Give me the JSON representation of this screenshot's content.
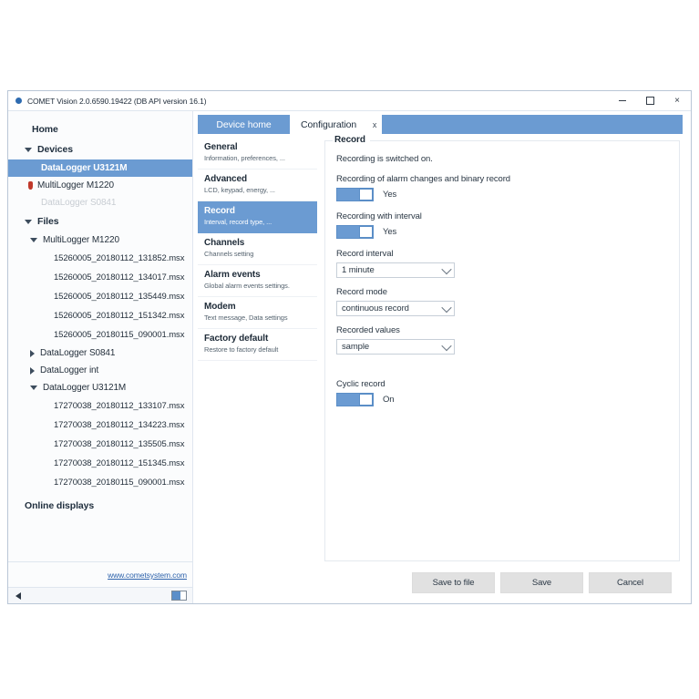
{
  "window": {
    "title": "COMET Vision 2.0.6590.19422 (DB API version 16.1)",
    "minimize_label": "",
    "maximize_label": "",
    "close_label": "×"
  },
  "sidebar": {
    "home_label": "Home",
    "devices_label": "Devices",
    "devices": [
      {
        "label": "DataLogger U3121M",
        "state": "selected"
      },
      {
        "label": "MultiLogger M1220",
        "state": "alarm"
      },
      {
        "label": "DataLogger S0841",
        "state": "disabled"
      }
    ],
    "files_label": "Files",
    "file_groups": [
      {
        "label": "MultiLogger M1220",
        "expanded": true,
        "files": [
          "15260005_20180112_131852.msx",
          "15260005_20180112_134017.msx",
          "15260005_20180112_135449.msx",
          "15260005_20180112_151342.msx",
          "15260005_20180115_090001.msx"
        ]
      },
      {
        "label": "DataLogger S0841",
        "expanded": false,
        "files": []
      },
      {
        "label": "DataLogger int",
        "expanded": false,
        "files": []
      },
      {
        "label": "DataLogger U3121M",
        "expanded": true,
        "files": [
          "17270038_20180112_133107.msx",
          "17270038_20180112_134223.msx",
          "17270038_20180112_135505.msx",
          "17270038_20180112_151345.msx",
          "17270038_20180115_090001.msx"
        ]
      }
    ],
    "online_displays_label": "Online displays",
    "web_link": "www.cometsystem.com"
  },
  "tabs": [
    {
      "label": "Device home",
      "active": true
    },
    {
      "label": "Configuration",
      "active": false
    }
  ],
  "tab_close_label": "x",
  "config_nav": [
    {
      "title": "General",
      "subtitle": "Information, preferences, ...",
      "active": false
    },
    {
      "title": "Advanced",
      "subtitle": "LCD, keypad, energy, ...",
      "active": false
    },
    {
      "title": "Record",
      "subtitle": "Interval, record type, ...",
      "active": true
    },
    {
      "title": "Channels",
      "subtitle": "Channels setting",
      "active": false
    },
    {
      "title": "Alarm events",
      "subtitle": "Global alarm events settings.",
      "active": false
    },
    {
      "title": "Modem",
      "subtitle": "Text message, Data settings",
      "active": false
    },
    {
      "title": "Factory default",
      "subtitle": "Restore to factory default",
      "active": false
    }
  ],
  "record": {
    "card_title": "Record",
    "status_text": "Recording is switched on.",
    "alarm_binary_label": "Recording of alarm changes and binary record",
    "alarm_binary_value": "Yes",
    "interval_toggle_label": "Recording with interval",
    "interval_toggle_value": "Yes",
    "record_interval_label": "Record interval",
    "record_interval_value": "1 minute",
    "record_mode_label": "Record mode",
    "record_mode_value": "continuous record",
    "recorded_values_label": "Recorded values",
    "recorded_values_value": "sample",
    "cyclic_record_label": "Cyclic record",
    "cyclic_record_value": "On"
  },
  "buttons": {
    "save_to_file": "Save to file",
    "save": "Save",
    "cancel": "Cancel"
  },
  "colors": {
    "accent": "#6b9bd2",
    "alarm": "#c0392b",
    "link": "#2d62ab",
    "button": "#e1e1e1"
  }
}
